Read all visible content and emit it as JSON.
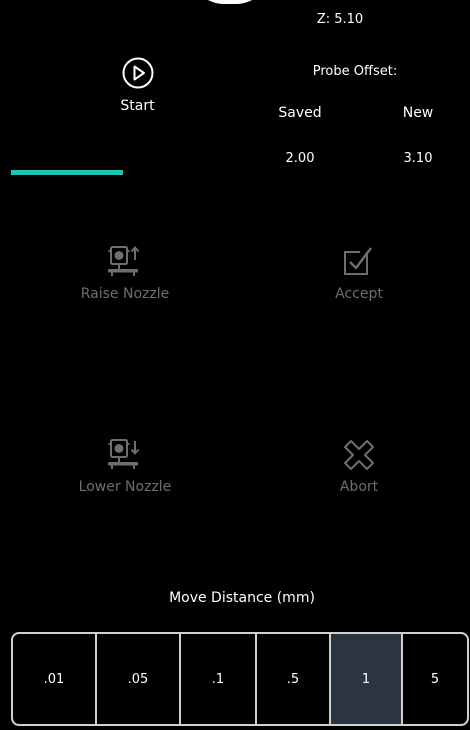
{
  "status": {
    "z_label": "Z: 5.10"
  },
  "start": {
    "label": "Start",
    "icon": "play-circle-icon"
  },
  "probe_offset": {
    "title": "Probe Offset:",
    "saved_header": "Saved",
    "new_header": "New",
    "saved_value": "2.00",
    "new_value": "3.10"
  },
  "progress": {
    "fraction": 0.49,
    "color": "#1ec4b4"
  },
  "actions": {
    "raise": {
      "label": "Raise Nozzle",
      "icon": "raise-nozzle-icon"
    },
    "accept": {
      "label": "Accept",
      "icon": "accept-checkbox-icon"
    },
    "lower": {
      "label": "Lower Nozzle",
      "icon": "lower-nozzle-icon"
    },
    "abort": {
      "label": "Abort",
      "icon": "abort-x-icon"
    }
  },
  "move_distance": {
    "title": "Move Distance (mm)",
    "options": [
      ".01",
      ".05",
      ".1",
      ".5",
      "1",
      "5"
    ],
    "selected_index": 4,
    "selected_color": "#2b3440"
  }
}
